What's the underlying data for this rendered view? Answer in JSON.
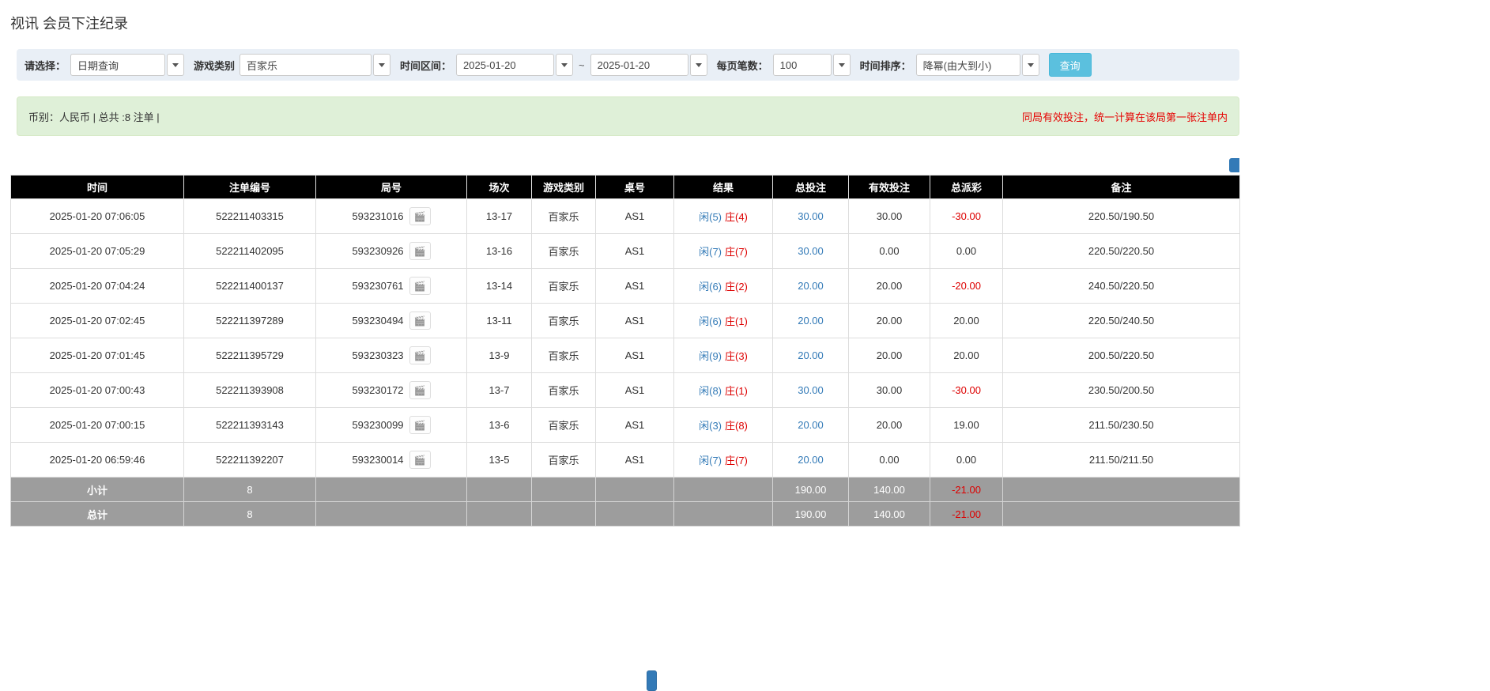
{
  "page": {
    "title": "视讯 会员下注纪录"
  },
  "colors": {
    "accent_blue": "#337ab7",
    "alert_red": "#dd0000",
    "info_button_bg": "#5bc0de",
    "filter_bar_bg": "#e9eff6",
    "summary_bar_bg": "#dff0d8",
    "table_header_bg": "#000000",
    "table_footer_bg": "#9d9d9d"
  },
  "filters": {
    "query_type_label": "请选择：",
    "query_type_value": "日期查询",
    "game_type_label": "游戏类别",
    "game_type_value": "百家乐",
    "date_range_label": "时间区间：",
    "date_from": "2025-01-20",
    "range_separator": "~",
    "date_to": "2025-01-20",
    "per_page_label": "每页笔数：",
    "per_page_value": "100",
    "sort_label": "时间排序：",
    "sort_value": "降幂(由大到小)",
    "search_button_label": "查询"
  },
  "summary": {
    "left_text": "币别：人民币 | 总共 :8 注单 |",
    "right_text": "同局有效投注，统一计算在该局第一张注单内"
  },
  "table": {
    "headers": [
      "时间",
      "注单编号",
      "局号",
      "场次",
      "游戏类别",
      "桌号",
      "结果",
      "总投注",
      "有效投注",
      "总派彩",
      "备注"
    ],
    "rows": [
      {
        "time": "2025-01-20 07:06:05",
        "bet_id": "522211403315",
        "round_id": "593231016",
        "session": "13-17",
        "game": "百家乐",
        "table_no": "AS1",
        "result_player": "闲(5)",
        "result_banker": "庄(4)",
        "total_bet": "30.00",
        "valid_bet": "30.00",
        "payout": "-30.00",
        "remark": "220.50/190.50"
      },
      {
        "time": "2025-01-20 07:05:29",
        "bet_id": "522211402095",
        "round_id": "593230926",
        "session": "13-16",
        "game": "百家乐",
        "table_no": "AS1",
        "result_player": "闲(7)",
        "result_banker": "庄(7)",
        "total_bet": "30.00",
        "valid_bet": "0.00",
        "payout": "0.00",
        "remark": "220.50/220.50"
      },
      {
        "time": "2025-01-20 07:04:24",
        "bet_id": "522211400137",
        "round_id": "593230761",
        "session": "13-14",
        "game": "百家乐",
        "table_no": "AS1",
        "result_player": "闲(6)",
        "result_banker": "庄(2)",
        "total_bet": "20.00",
        "valid_bet": "20.00",
        "payout": "-20.00",
        "remark": "240.50/220.50"
      },
      {
        "time": "2025-01-20 07:02:45",
        "bet_id": "522211397289",
        "round_id": "593230494",
        "session": "13-11",
        "game": "百家乐",
        "table_no": "AS1",
        "result_player": "闲(6)",
        "result_banker": "庄(1)",
        "total_bet": "20.00",
        "valid_bet": "20.00",
        "payout": "20.00",
        "remark": "220.50/240.50"
      },
      {
        "time": "2025-01-20 07:01:45",
        "bet_id": "522211395729",
        "round_id": "593230323",
        "session": "13-9",
        "game": "百家乐",
        "table_no": "AS1",
        "result_player": "闲(9)",
        "result_banker": "庄(3)",
        "total_bet": "20.00",
        "valid_bet": "20.00",
        "payout": "20.00",
        "remark": "200.50/220.50"
      },
      {
        "time": "2025-01-20 07:00:43",
        "bet_id": "522211393908",
        "round_id": "593230172",
        "session": "13-7",
        "game": "百家乐",
        "table_no": "AS1",
        "result_player": "闲(8)",
        "result_banker": "庄(1)",
        "total_bet": "30.00",
        "valid_bet": "30.00",
        "payout": "-30.00",
        "remark": "230.50/200.50"
      },
      {
        "time": "2025-01-20 07:00:15",
        "bet_id": "522211393143",
        "round_id": "593230099",
        "session": "13-6",
        "game": "百家乐",
        "table_no": "AS1",
        "result_player": "闲(3)",
        "result_banker": "庄(8)",
        "total_bet": "20.00",
        "valid_bet": "20.00",
        "payout": "19.00",
        "remark": "211.50/230.50"
      },
      {
        "time": "2025-01-20 06:59:46",
        "bet_id": "522211392207",
        "round_id": "593230014",
        "session": "13-5",
        "game": "百家乐",
        "table_no": "AS1",
        "result_player": "闲(7)",
        "result_banker": "庄(7)",
        "total_bet": "20.00",
        "valid_bet": "0.00",
        "payout": "0.00",
        "remark": "211.50/211.50"
      }
    ],
    "subtotal": {
      "label": "小计",
      "count": "8",
      "total_bet": "190.00",
      "valid_bet": "140.00",
      "payout": "-21.00"
    },
    "total": {
      "label": "总计",
      "count": "8",
      "total_bet": "190.00",
      "valid_bet": "140.00",
      "payout": "-21.00"
    }
  }
}
